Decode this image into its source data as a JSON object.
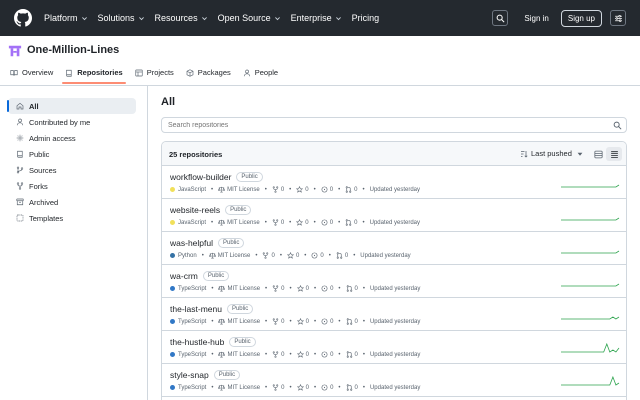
{
  "header": {
    "nav": [
      "Platform",
      "Solutions",
      "Resources",
      "Open Source",
      "Enterprise",
      "Pricing"
    ],
    "nav_has_caret": [
      true,
      true,
      true,
      true,
      true,
      false
    ],
    "sign_in": "Sign in",
    "sign_up": "Sign up"
  },
  "org": {
    "name": "One-Million-Lines",
    "tabs": [
      {
        "label": "Overview",
        "icon": "book-open-icon"
      },
      {
        "label": "Repositories",
        "icon": "repo-icon",
        "active": true
      },
      {
        "label": "Projects",
        "icon": "table-icon"
      },
      {
        "label": "Packages",
        "icon": "package-icon"
      },
      {
        "label": "People",
        "icon": "person-icon"
      }
    ]
  },
  "sidebar": {
    "items": [
      {
        "label": "All",
        "icon": "home-icon",
        "active": true
      },
      {
        "label": "Contributed by me",
        "icon": "person-icon"
      },
      {
        "label": "Admin access",
        "icon": "gear-icon"
      },
      {
        "label": "Public",
        "icon": "repo-icon"
      },
      {
        "label": "Sources",
        "icon": "sources-icon"
      },
      {
        "label": "Forks",
        "icon": "fork-icon"
      },
      {
        "label": "Archived",
        "icon": "archive-icon"
      },
      {
        "label": "Templates",
        "icon": "template-icon"
      }
    ]
  },
  "main": {
    "title": "All",
    "search_placeholder": "Search repositories",
    "count": "25 repositories",
    "sort_label": "Last pushed"
  },
  "repos": [
    {
      "name": "workflow-builder",
      "visibility": "Public",
      "language": "JavaScript",
      "lang_color": "#f1e05a",
      "license": "MIT License",
      "forks": "0",
      "stars": "0",
      "issues": "0",
      "prs": "0",
      "updated": "Updated yesterday",
      "activity": [
        0,
        0,
        0,
        0,
        0,
        0,
        0,
        0,
        0,
        0,
        0,
        0,
        0,
        0,
        0,
        0,
        0,
        0,
        0,
        1
      ]
    },
    {
      "name": "website-reels",
      "visibility": "Public",
      "language": "JavaScript",
      "lang_color": "#f1e05a",
      "license": "MIT License",
      "forks": "0",
      "stars": "0",
      "issues": "0",
      "prs": "0",
      "updated": "Updated yesterday",
      "activity": [
        0,
        0,
        0,
        0,
        0,
        0,
        0,
        0,
        0,
        0,
        0,
        0,
        0,
        0,
        0,
        0,
        0,
        0,
        0,
        1
      ]
    },
    {
      "name": "was-helpful",
      "visibility": "Public",
      "language": "Python",
      "lang_color": "#3572A5",
      "license": "MIT License",
      "forks": "0",
      "stars": "0",
      "issues": "0",
      "prs": "0",
      "updated": "Updated yesterday",
      "activity": [
        0,
        0,
        0,
        0,
        0,
        0,
        0,
        0,
        0,
        0,
        0,
        0,
        0,
        0,
        0,
        0,
        0,
        0,
        0,
        1
      ]
    },
    {
      "name": "wa-crm",
      "visibility": "Public",
      "language": "TypeScript",
      "lang_color": "#3178c6",
      "license": "MIT License",
      "forks": "0",
      "stars": "0",
      "issues": "0",
      "prs": "0",
      "updated": "Updated yesterday",
      "activity": [
        0,
        0,
        0,
        0,
        0,
        0,
        0,
        0,
        0,
        0,
        0,
        0,
        0,
        0,
        0,
        0,
        0,
        0,
        0,
        1
      ]
    },
    {
      "name": "the-last-menu",
      "visibility": "Public",
      "language": "TypeScript",
      "lang_color": "#3178c6",
      "license": "MIT License",
      "forks": "0",
      "stars": "0",
      "issues": "0",
      "prs": "0",
      "updated": "Updated yesterday",
      "activity": [
        0,
        0,
        0,
        0,
        0,
        0,
        0,
        0,
        0,
        0,
        0,
        0,
        0,
        0,
        0,
        0,
        0,
        1,
        0,
        1
      ]
    },
    {
      "name": "the-hustle-hub",
      "visibility": "Public",
      "language": "TypeScript",
      "lang_color": "#3178c6",
      "license": "MIT License",
      "forks": "0",
      "stars": "0",
      "issues": "0",
      "prs": "0",
      "updated": "Updated yesterday",
      "activity": [
        0,
        0,
        0,
        0,
        0,
        0,
        0,
        0,
        0,
        0,
        0,
        0,
        0,
        0,
        0,
        4,
        0,
        1,
        0,
        2
      ]
    },
    {
      "name": "style-snap",
      "visibility": "Public",
      "language": "TypeScript",
      "lang_color": "#3178c6",
      "license": "MIT License",
      "forks": "0",
      "stars": "0",
      "issues": "0",
      "prs": "0",
      "updated": "Updated yesterday",
      "activity": [
        0,
        0,
        0,
        0,
        0,
        0,
        0,
        0,
        0,
        0,
        0,
        0,
        0,
        0,
        0,
        0,
        0,
        4,
        0,
        1
      ]
    }
  ],
  "colors": {
    "header_bg": "#24292f",
    "active_tab_underline": "#fd8c73",
    "accent_blue": "#0969da",
    "spark_green": "#2da44e"
  }
}
